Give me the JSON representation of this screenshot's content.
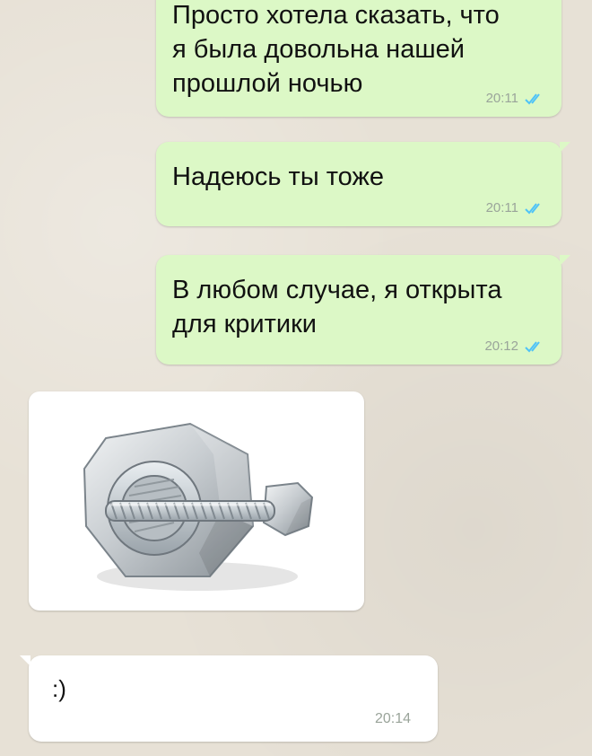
{
  "chat": {
    "messages": [
      {
        "text": "Просто хотела сказать, что\nя была довольна нашей\nпрошлой ночью",
        "time": "20:11"
      },
      {
        "text": "Надеюсь ты тоже",
        "time": "20:11"
      },
      {
        "text": "В любом случае, я открыта\nдля критики",
        "time": "20:12"
      },
      {
        "image_subject": "nut-and-bolt-photo"
      },
      {
        "text": ":)",
        "time": "20:14"
      }
    ],
    "status_icon": "double-check-icon",
    "colors": {
      "outgoing_bubble": "#dcf8c6",
      "incoming_bubble": "#ffffff",
      "read_ticks": "#4fc3f7"
    }
  }
}
